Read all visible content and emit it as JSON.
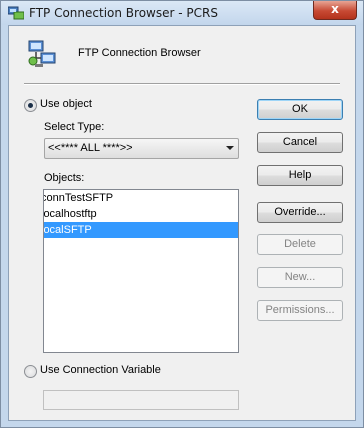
{
  "window": {
    "title": "FTP Connection Browser - PCRS",
    "close_label": "x"
  },
  "header": {
    "title": "FTP Connection Browser",
    "icon": "ftp-network-icon"
  },
  "use_object": {
    "label": "Use object",
    "checked": true
  },
  "select_type": {
    "label": "Select Type:",
    "value": "<<**** ALL ****>>"
  },
  "objects": {
    "label": "Objects:",
    "items": [
      "connTestSFTP",
      "localhostftp",
      "localSFTP"
    ],
    "selected_index": 2
  },
  "use_connection_variable": {
    "label": "Use Connection Variable",
    "checked": false,
    "value": ""
  },
  "buttons": {
    "ok": "OK",
    "cancel": "Cancel",
    "help": "Help",
    "override": "Override...",
    "delete": "Delete",
    "new": "New...",
    "permissions": "Permissions..."
  },
  "colors": {
    "selection": "#3399ff",
    "title_gradient": "#c3d6ec",
    "close_button": "#c74a34"
  }
}
